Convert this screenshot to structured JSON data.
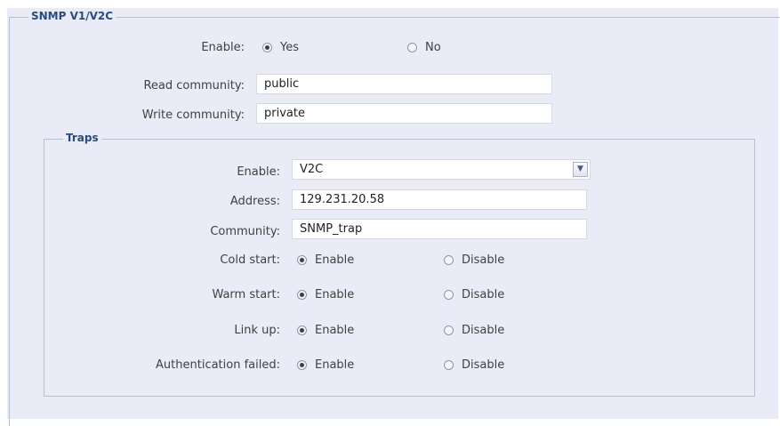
{
  "snmp": {
    "legend": "SNMP V1/V2C",
    "enable_label": "Enable:",
    "enable_yes": "Yes",
    "enable_no": "No",
    "read_community_label": "Read community:",
    "read_community_value": "public",
    "write_community_label": "Write community:",
    "write_community_value": "private"
  },
  "traps": {
    "legend": "Traps",
    "enable_label": "Enable:",
    "enable_value": "V2C",
    "address_label": "Address:",
    "address_value": "129.231.20.58",
    "community_label": "Community:",
    "community_value": "SNMP_trap",
    "option_enable": "Enable",
    "option_disable": "Disable",
    "rows": [
      {
        "label": "Cold start:",
        "selected": "Enable"
      },
      {
        "label": "Warm start:",
        "selected": "Enable"
      },
      {
        "label": "Link up:",
        "selected": "Enable"
      },
      {
        "label": "Authentication failed:",
        "selected": "Enable"
      }
    ]
  },
  "icons": {
    "select_arrow": "chevron-down-icon"
  }
}
